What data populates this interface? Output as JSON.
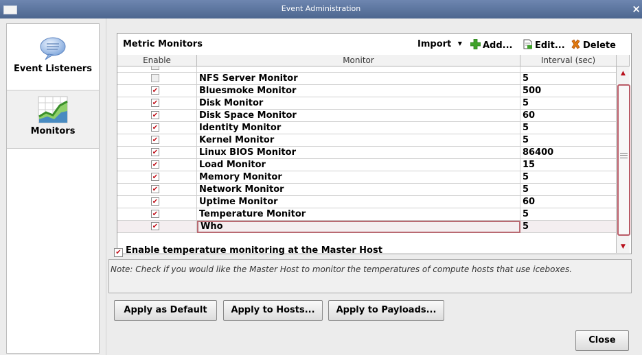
{
  "window": {
    "title": "Event Administration",
    "close_glyph": "×"
  },
  "sidebar": {
    "items": [
      {
        "label": "Event Listeners",
        "icon": "speech-bubble-icon"
      },
      {
        "label": "Monitors",
        "icon": "chart-icon"
      }
    ]
  },
  "table": {
    "title": "Metric Monitors",
    "toolbar": {
      "import": "Import",
      "add": "Add...",
      "edit": "Edit...",
      "delete": "Delete"
    },
    "columns": [
      "Enable",
      "Monitor",
      "Interval (sec)"
    ],
    "rows": [
      {
        "enabled": false,
        "monitor": "NFS Server Monitor",
        "interval": "5"
      },
      {
        "enabled": true,
        "monitor": "Bluesmoke Monitor",
        "interval": "500"
      },
      {
        "enabled": true,
        "monitor": "Disk Monitor",
        "interval": "5"
      },
      {
        "enabled": true,
        "monitor": "Disk Space Monitor",
        "interval": "60"
      },
      {
        "enabled": true,
        "monitor": "Identity Monitor",
        "interval": "5"
      },
      {
        "enabled": true,
        "monitor": "Kernel Monitor",
        "interval": "5"
      },
      {
        "enabled": true,
        "monitor": "Linux BIOS Monitor",
        "interval": "86400"
      },
      {
        "enabled": true,
        "monitor": "Load Monitor",
        "interval": "15"
      },
      {
        "enabled": true,
        "monitor": "Memory Monitor",
        "interval": "5"
      },
      {
        "enabled": true,
        "monitor": "Network Monitor",
        "interval": "5"
      },
      {
        "enabled": true,
        "monitor": "Uptime Monitor",
        "interval": "60"
      },
      {
        "enabled": true,
        "monitor": "Temperature Monitor",
        "interval": "5"
      },
      {
        "enabled": true,
        "monitor": "Who",
        "interval": "5"
      }
    ]
  },
  "temperature": {
    "label": "Enable temperature monitoring at the Master Host",
    "checked": true
  },
  "note": "Note: Check if you would like the Master Host to monitor the temperatures of compute hosts that use iceboxes.",
  "buttons": {
    "apply_default": "Apply as Default",
    "apply_hosts": "Apply to Hosts...",
    "apply_payloads": "Apply to Payloads...",
    "close": "Close"
  },
  "colors": {
    "accent": "#b96a72",
    "check": "#c1121b",
    "add_icon": "#3fa22a",
    "delete_icon": "#e07a10"
  }
}
